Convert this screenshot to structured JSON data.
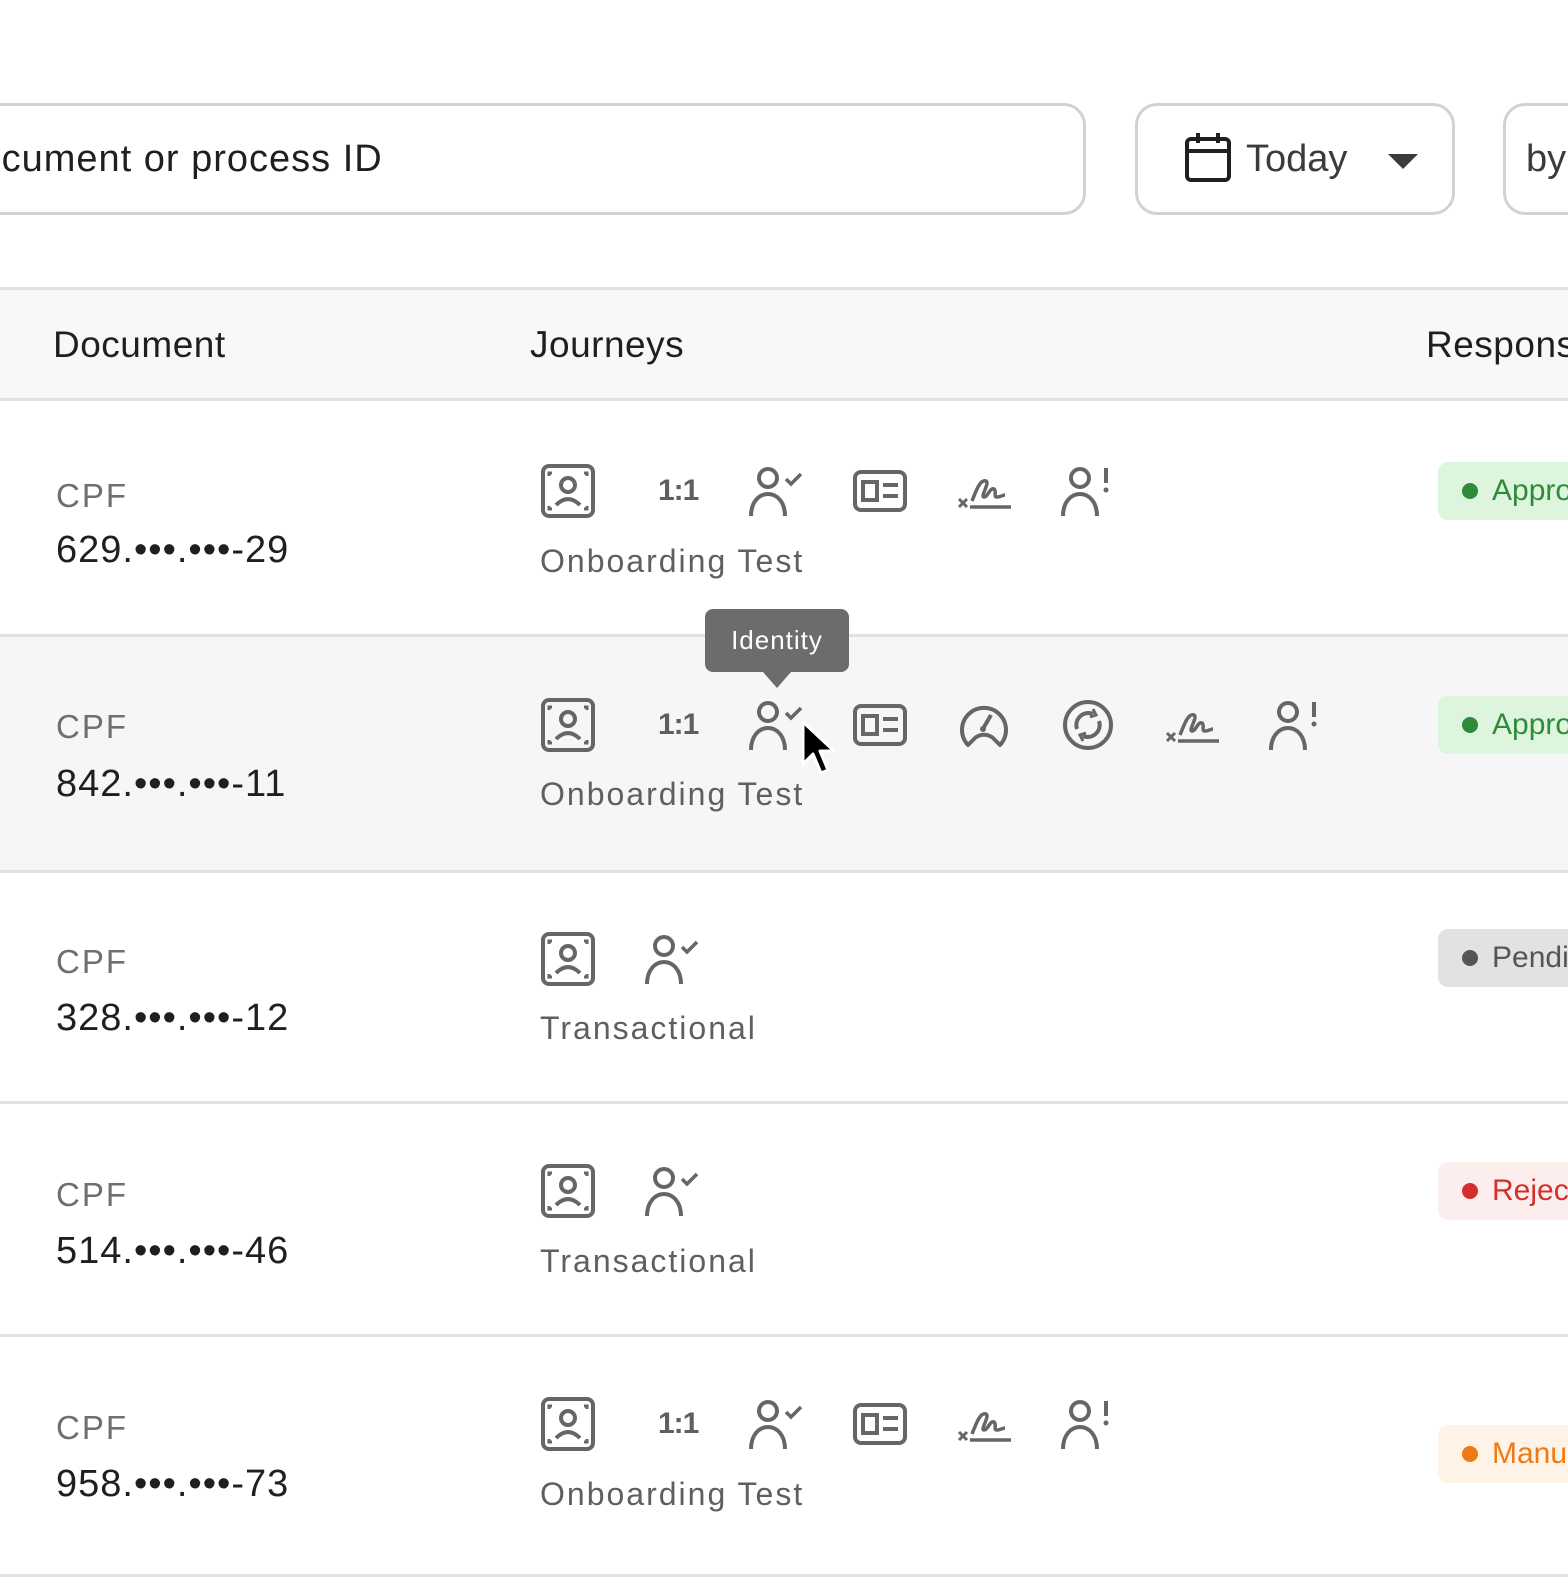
{
  "search": {
    "placeholder": "Document or process ID"
  },
  "date_filter": {
    "label": "Today",
    "icon": "calendar-icon"
  },
  "sort_filter": {
    "label": "by"
  },
  "table": {
    "headers": {
      "document": "Document",
      "journeys": "Journeys",
      "response": "Response"
    },
    "rows": [
      {
        "doc_type": "CPF",
        "doc_number": "629.•••.•••-29",
        "icons": [
          "face-scan-icon",
          "ratio-icon",
          "identity-icon",
          "id-card-icon",
          "signature-icon",
          "user-alert-icon"
        ],
        "journey": "Onboarding Test",
        "status": "Approved",
        "status_color": "#2e8b3a",
        "status_bg": "#dcf5dc"
      },
      {
        "doc_type": "CPF",
        "doc_number": "842.•••.•••-11",
        "icons": [
          "face-scan-icon",
          "ratio-icon",
          "identity-icon",
          "id-card-icon",
          "gauge-icon",
          "liveness-icon",
          "signature-icon",
          "user-alert-icon"
        ],
        "journey": "Onboarding Test",
        "status": "Approved",
        "status_color": "#2e8b3a",
        "status_bg": "#dcf5dc"
      },
      {
        "doc_type": "CPF",
        "doc_number": "328.•••.•••-12",
        "icons": [
          "face-scan-icon",
          "identity-icon"
        ],
        "journey": "Transactional",
        "status": "Pending",
        "status_color": "#555555",
        "status_bg": "#e2e2e2"
      },
      {
        "doc_type": "CPF",
        "doc_number": "514.•••.•••-46",
        "icons": [
          "face-scan-icon",
          "identity-icon"
        ],
        "journey": "Transactional",
        "status": "Rejected",
        "status_color": "#d32f2f",
        "status_bg": "#fdeeee"
      },
      {
        "doc_type": "CPF",
        "doc_number": "958.•••.•••-73",
        "icons": [
          "face-scan-icon",
          "ratio-icon",
          "identity-icon",
          "id-card-icon",
          "signature-icon",
          "user-alert-icon"
        ],
        "journey": "Onboarding Test",
        "status": "Manual",
        "status_color": "#ee7a16",
        "status_bg": "#fff2e6"
      }
    ],
    "ratio_label": "1:1"
  },
  "tooltip": {
    "text": "Identity"
  }
}
